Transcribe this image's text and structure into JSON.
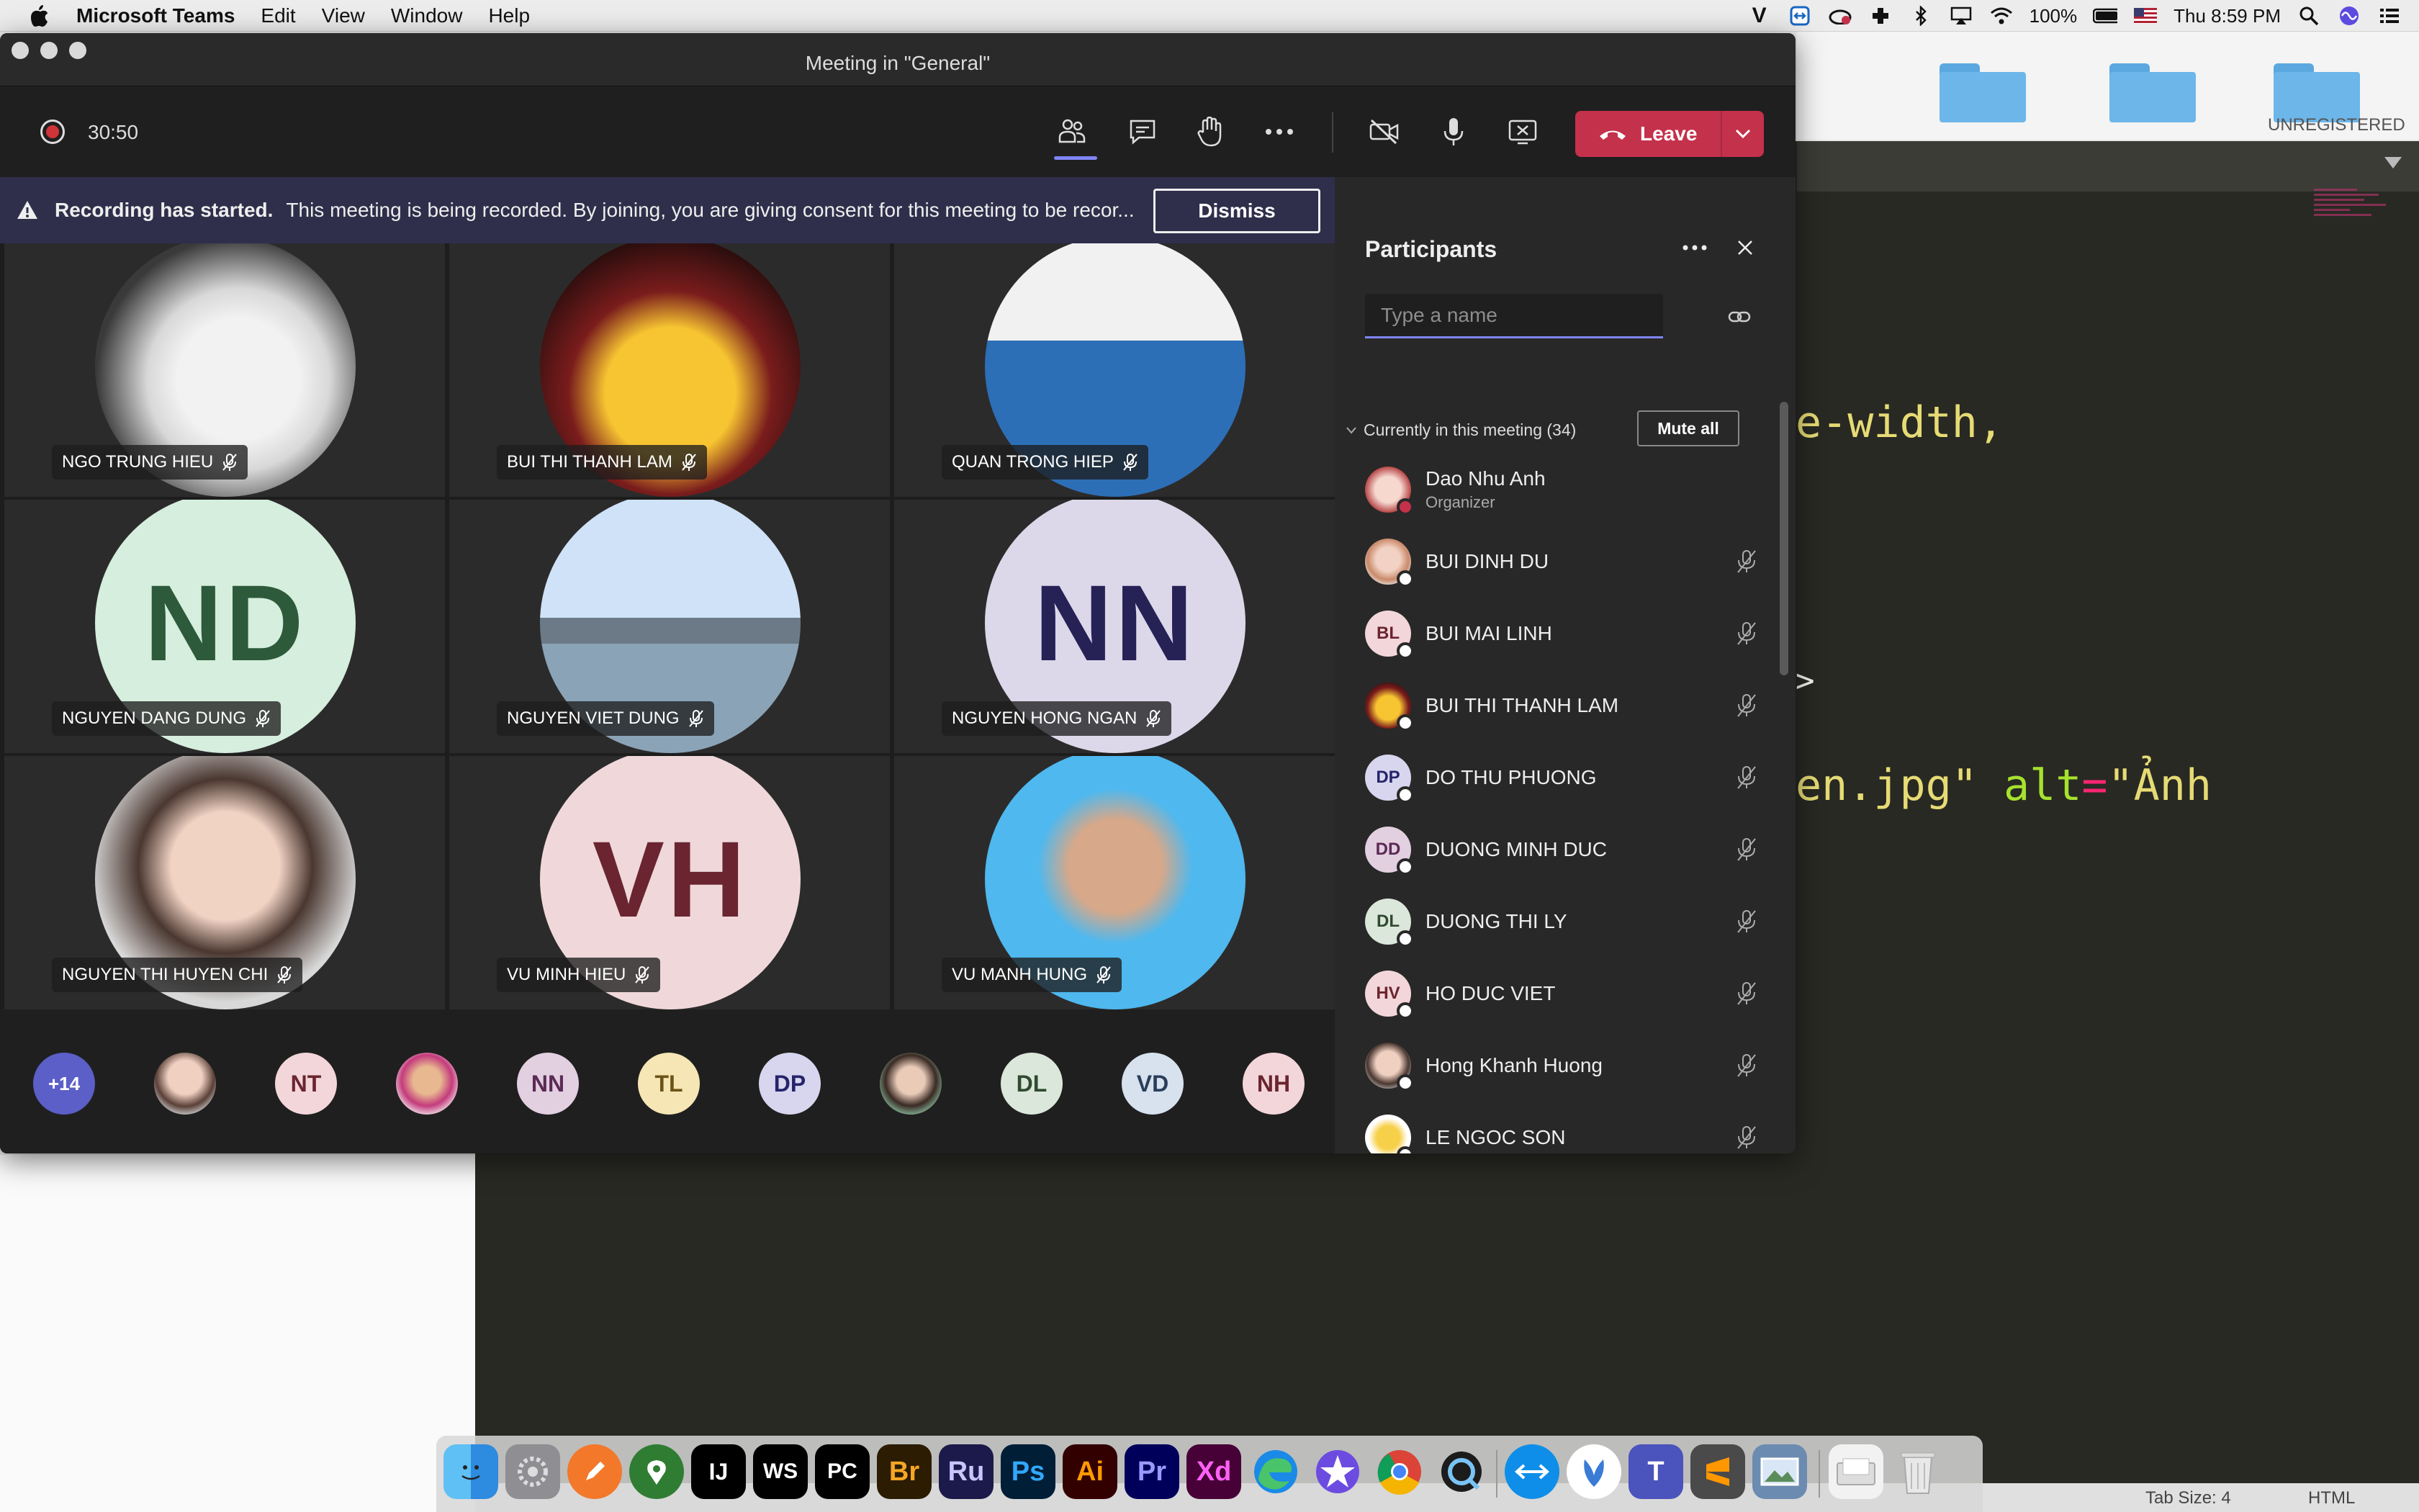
{
  "menubar": {
    "app_name": "Microsoft Teams",
    "menus": [
      "Edit",
      "View",
      "Window",
      "Help"
    ],
    "battery": "100%",
    "datetime": "Thu 8:59 PM"
  },
  "background_editor": {
    "unregistered": "UNREGISTERED",
    "code": {
      "line1": "e-width,",
      "line2": ">",
      "line3_a": "en.jpg\"",
      "line3_b": " alt",
      "line3_c": "=",
      "line3_d": "\"Ảnh"
    },
    "status": {
      "tab_size": "Tab Size: 4",
      "syntax": "HTML"
    }
  },
  "teams": {
    "window_title": "Meeting in \"General\"",
    "timer": "30:50",
    "leave_label": "Leave",
    "banner": {
      "title": "Recording has started.",
      "message": "This meeting is being recorded. By joining, you are giving consent for this meeting to be recor...",
      "dismiss_label": "Dismiss"
    },
    "tiles": [
      {
        "name": "NGO TRUNG HIEU",
        "initials": ""
      },
      {
        "name": "BUI THI THANH LAM",
        "initials": ""
      },
      {
        "name": "QUAN TRONG HIEP",
        "initials": ""
      },
      {
        "name": "NGUYEN DANG DUNG",
        "initials": "ND"
      },
      {
        "name": "NGUYEN VIET DUNG",
        "initials": ""
      },
      {
        "name": "NGUYEN HONG NGAN",
        "initials": "NN"
      },
      {
        "name": "NGUYEN THI HUYEN CHI",
        "initials": ""
      },
      {
        "name": "VU MINH HIEU",
        "initials": "VH"
      },
      {
        "name": "VU MANH HUNG",
        "initials": ""
      }
    ],
    "strip": {
      "overflow": "+14",
      "initials": [
        "NT",
        "NN",
        "TL",
        "DP",
        "DL",
        "VD",
        "NH"
      ]
    },
    "participants": {
      "title": "Participants",
      "search_placeholder": "Type a name",
      "section_label": "Currently in this meeting (34)",
      "mute_all_label": "Mute all",
      "organizer": {
        "name": "Dao Nhu Anh",
        "role": "Organizer"
      },
      "people": [
        {
          "name": "BUI DINH DU",
          "initials": ""
        },
        {
          "name": "BUI MAI LINH",
          "initials": "BL"
        },
        {
          "name": "BUI THI THANH LAM",
          "initials": ""
        },
        {
          "name": "DO THU PHUONG",
          "initials": "DP"
        },
        {
          "name": "DUONG MINH DUC",
          "initials": "DD"
        },
        {
          "name": "DUONG THI LY",
          "initials": "DL"
        },
        {
          "name": "HO DUC VIET",
          "initials": "HV"
        },
        {
          "name": "Hong Khanh Huong",
          "initials": ""
        },
        {
          "name": "LE NGOC SON",
          "initials": ""
        }
      ]
    }
  },
  "dock": {
    "labels": [
      "IJ",
      "WS",
      "PC",
      "Br",
      "Ru",
      "Ps",
      "Ai",
      "Pr",
      "Xd",
      "T"
    ]
  },
  "colors": {
    "accent": "#7f85f5",
    "leave": "#c4314b",
    "banner": "#2f2f4b"
  }
}
